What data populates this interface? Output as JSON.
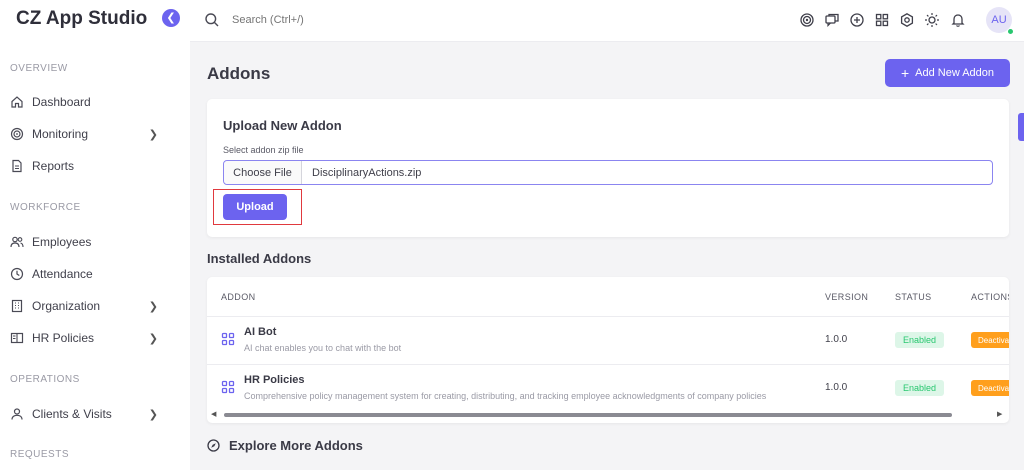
{
  "sidebar": {
    "brand": "CZ App Studio",
    "sections": [
      {
        "label": "OVERVIEW"
      },
      {
        "label": "WORKFORCE"
      },
      {
        "label": "OPERATIONS"
      },
      {
        "label": "REQUESTS"
      }
    ],
    "items": [
      {
        "label": "Dashboard",
        "icon": "home-icon",
        "has_submenu": false
      },
      {
        "label": "Monitoring",
        "icon": "target-icon",
        "has_submenu": true
      },
      {
        "label": "Reports",
        "icon": "document-icon",
        "has_submenu": false
      },
      {
        "label": "Employees",
        "icon": "users-icon",
        "has_submenu": false
      },
      {
        "label": "Attendance",
        "icon": "clock-icon",
        "has_submenu": false
      },
      {
        "label": "Organization",
        "icon": "building-icon",
        "has_submenu": true
      },
      {
        "label": "HR Policies",
        "icon": "book-icon",
        "has_submenu": true
      },
      {
        "label": "Clients & Visits",
        "icon": "user-pin-icon",
        "has_submenu": true
      }
    ]
  },
  "topbar": {
    "search_placeholder": "Search (Ctrl+/)",
    "avatar_initials": "AU",
    "icons": [
      "target-icon",
      "chat-icon",
      "plus-circle-icon",
      "grid-icon",
      "settings-icon",
      "sun-icon",
      "bell-icon"
    ]
  },
  "page": {
    "title": "Addons",
    "add_button_label": "Add New Addon"
  },
  "upload": {
    "title": "Upload New Addon",
    "field_label": "Select addon zip file",
    "choose_label": "Choose File",
    "file_name": "DisciplinaryActions.zip",
    "upload_label": "Upload"
  },
  "installed": {
    "title": "Installed Addons",
    "columns": [
      "ADDON",
      "VERSION",
      "STATUS",
      "ACTIONS"
    ],
    "rows": [
      {
        "name": "AI Bot",
        "description": "AI chat enables you to chat with the bot",
        "version": "1.0.0",
        "status": "Enabled",
        "action": "Deactivate"
      },
      {
        "name": "HR Policies",
        "description": "Comprehensive policy management system for creating, distributing, and tracking employee acknowledgments of company policies",
        "version": "1.0.0",
        "status": "Enabled",
        "action": "Deactivate"
      }
    ]
  },
  "explore": {
    "title": "Explore More Addons"
  },
  "colors": {
    "accent": "#6c63ef",
    "enabled_bg": "#ddf6e8",
    "enabled_text": "#28c76f",
    "deactivate_bg": "#ff9f1c",
    "highlight": "#e0393e"
  }
}
